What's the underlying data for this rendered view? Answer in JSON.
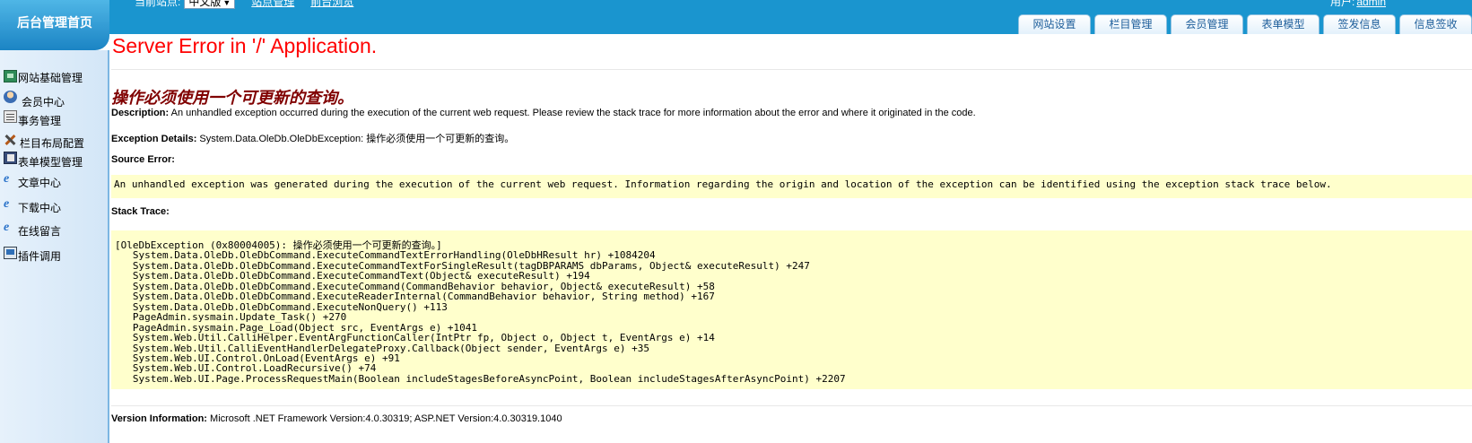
{
  "header": {
    "logo_text": "后台管理首页",
    "site_switch_label": "当前站点:",
    "site_select_value": "中文版",
    "links": [
      "站点管理",
      "前台浏览"
    ],
    "user_label": "用户:",
    "user_name": "admin",
    "tabs": [
      "网站设置",
      "栏目管理",
      "会员管理",
      "表单模型",
      "签发信息",
      "信息签收"
    ]
  },
  "sidebar": {
    "items": [
      {
        "label": "网站基础管理",
        "icon": "folder-tree-icon"
      },
      {
        "label": "会员中心",
        "icon": "user-icon"
      },
      {
        "label": "事务管理",
        "icon": "document-icon"
      },
      {
        "label": "栏目布局配置",
        "icon": "tools-icon"
      },
      {
        "label": "表单模型管理",
        "icon": "book-icon"
      },
      {
        "label": "文章中心",
        "icon": "ie-icon"
      },
      {
        "label": "下载中心",
        "icon": "ie-icon"
      },
      {
        "label": "在线留言",
        "icon": "ie-icon"
      },
      {
        "label": "插件调用",
        "icon": "computer-icon"
      }
    ]
  },
  "error": {
    "title": "Server Error in '/' Application.",
    "message": "操作必须使用一个可更新的查询。",
    "description_label": "Description:",
    "description_text": "An unhandled exception occurred during the execution of the current web request. Please review the stack trace for more information about the error and where it originated in the code.",
    "exception_label": "Exception Details:",
    "exception_text": "System.Data.OleDb.OleDbException: 操作必须使用一个可更新的查询。",
    "source_label": "Source Error:",
    "source_text": "An unhandled exception was generated during the execution of the current web request. Information regarding the origin and location of the exception can be identified using the exception stack trace below.",
    "stack_label": "Stack Trace:",
    "stack_lines": [
      "[OleDbException (0x80004005): 操作必须使用一个可更新的查询。]",
      "   System.Data.OleDb.OleDbCommand.ExecuteCommandTextErrorHandling(OleDbHResult hr) +1084204",
      "   System.Data.OleDb.OleDbCommand.ExecuteCommandTextForSingleResult(tagDBPARAMS dbParams, Object& executeResult) +247",
      "   System.Data.OleDb.OleDbCommand.ExecuteCommandText(Object& executeResult) +194",
      "   System.Data.OleDb.OleDbCommand.ExecuteCommand(CommandBehavior behavior, Object& executeResult) +58",
      "   System.Data.OleDb.OleDbCommand.ExecuteReaderInternal(CommandBehavior behavior, String method) +167",
      "   System.Data.OleDb.OleDbCommand.ExecuteNonQuery() +113",
      "   PageAdmin.sysmain.Update_Task() +270",
      "   PageAdmin.sysmain.Page_Load(Object src, EventArgs e) +1041",
      "   System.Web.Util.CalliHelper.EventArgFunctionCaller(IntPtr fp, Object o, Object t, EventArgs e) +14",
      "   System.Web.Util.CalliEventHandlerDelegateProxy.Callback(Object sender, EventArgs e) +35",
      "   System.Web.UI.Control.OnLoad(EventArgs e) +91",
      "   System.Web.UI.Control.LoadRecursive() +74",
      "   System.Web.UI.Page.ProcessRequestMain(Boolean includeStagesBeforeAsyncPoint, Boolean includeStagesAfterAsyncPoint) +2207"
    ],
    "version_label": "Version Information:",
    "version_text": "Microsoft .NET Framework Version:4.0.30319; ASP.NET Version:4.0.30319.1040"
  },
  "colors": {
    "topbar": "#1a95cf",
    "title_red": "#ff0000",
    "message_maroon": "#800000",
    "code_bg": "#ffffcc"
  }
}
